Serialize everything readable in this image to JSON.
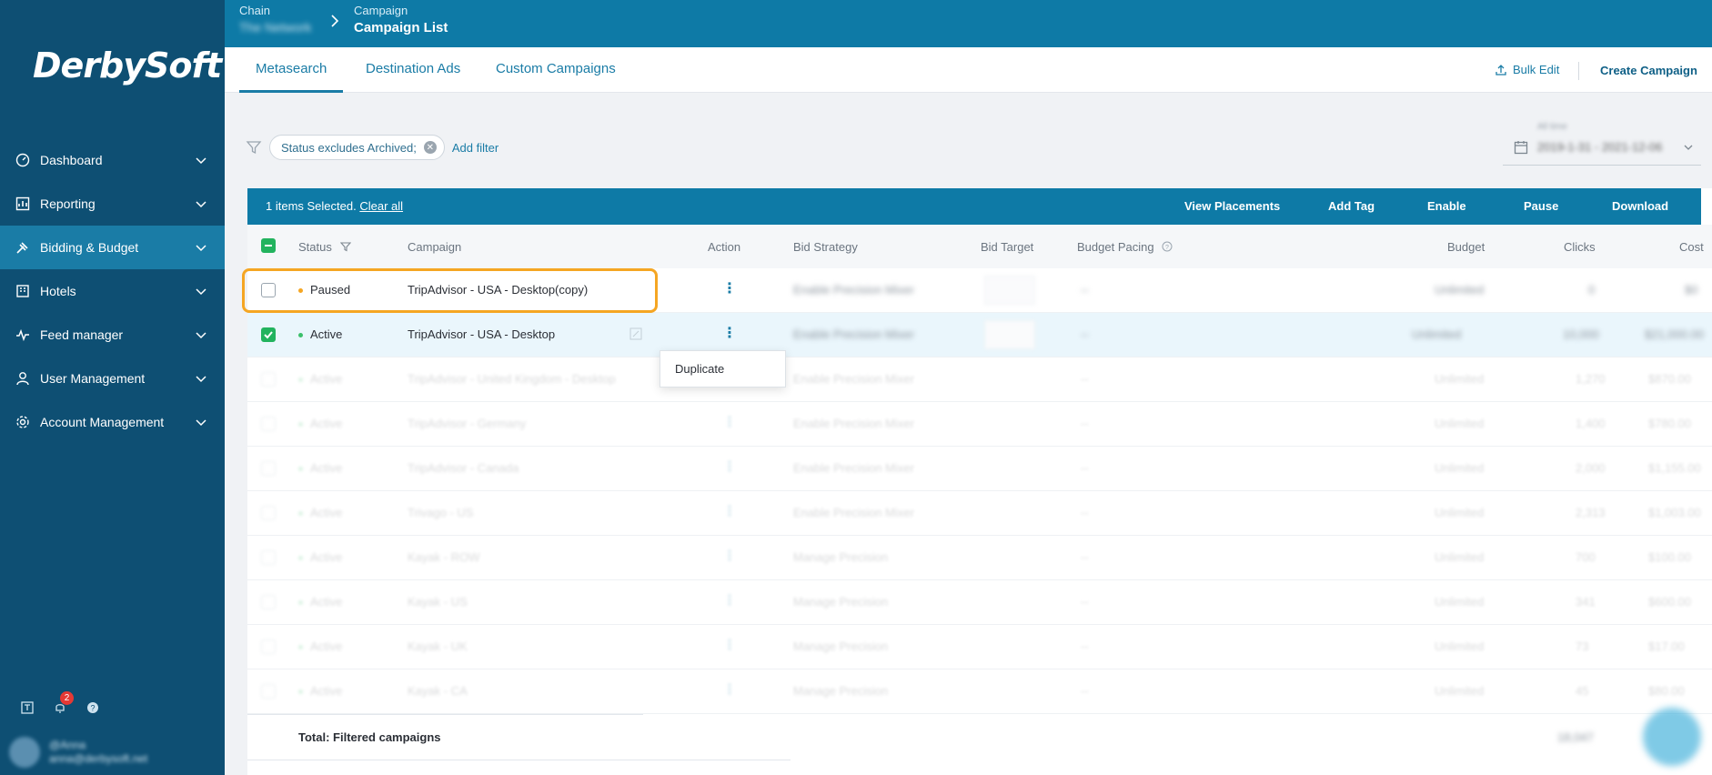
{
  "brand": {
    "logo": "DerbySoft"
  },
  "sidebar": {
    "items": [
      {
        "label": "Dashboard",
        "icon": "dashboard-icon"
      },
      {
        "label": "Reporting",
        "icon": "reporting-icon"
      },
      {
        "label": "Bidding & Budget",
        "icon": "bidding-icon",
        "active": true
      },
      {
        "label": "Hotels",
        "icon": "hotels-icon"
      },
      {
        "label": "Feed manager",
        "icon": "feed-icon"
      },
      {
        "label": "User Management",
        "icon": "user-icon"
      },
      {
        "label": "Account Management",
        "icon": "gear-icon"
      }
    ],
    "notification_count": "2",
    "user": {
      "name": "@Anna",
      "email": "anna@derbysoft.net"
    }
  },
  "header": {
    "chain_label": "Chain",
    "chain_value": "The Network",
    "campaign_label": "Campaign",
    "campaign_value": "Campaign List"
  },
  "tabs": [
    "Metasearch",
    "Destination Ads",
    "Custom Campaigns"
  ],
  "toolbar": {
    "bulk_edit": "Bulk Edit",
    "create_campaign": "Create Campaign"
  },
  "filters": {
    "chip": "Status excludes Archived;",
    "add_filter": "Add filter"
  },
  "date_range": {
    "label": "All time",
    "value": "2019-1-31 - 2021-12-06"
  },
  "action_bar": {
    "selected": "1 items Selected.",
    "clear_all": "Clear all",
    "buttons": [
      "View Placements",
      "Add Tag",
      "Enable",
      "Pause",
      "Download"
    ]
  },
  "columns": [
    "Status",
    "Campaign",
    "Action",
    "Bid Strategy",
    "Bid Target",
    "Budget Pacing",
    "Budget",
    "Clicks",
    "Cost"
  ],
  "rows": [
    {
      "status": "Paused",
      "dot": "orange",
      "campaign": "TripAdvisor - USA - Desktop(copy)",
      "strategy": "Enable Precision Mixer",
      "pacing": "--",
      "budget": "Unlimited",
      "clicks": "0",
      "cost": "$0"
    },
    {
      "status": "Active",
      "dot": "green",
      "campaign": "TripAdvisor - USA - Desktop",
      "strategy": "Enable Precision Mixer",
      "pacing": "--",
      "budget": "Unlimited",
      "clicks": "10,000",
      "cost": "$21,000.00"
    },
    {
      "status": "Active",
      "dot": "green",
      "campaign": "TripAdvisor - United Kingdom - Desktop",
      "strategy": "Enable Precision Mixer",
      "pacing": "--",
      "budget": "Unlimited",
      "clicks": "1,270",
      "cost": "$870.00"
    },
    {
      "status": "Active",
      "dot": "green",
      "campaign": "TripAdvisor - Germany",
      "strategy": "Enable Precision Mixer",
      "pacing": "--",
      "budget": "Unlimited",
      "clicks": "1,400",
      "cost": "$780.00"
    },
    {
      "status": "Active",
      "dot": "green",
      "campaign": "TripAdvisor - Canada",
      "strategy": "Enable Precision Mixer",
      "pacing": "--",
      "budget": "Unlimited",
      "clicks": "2,000",
      "cost": "$1,155.00"
    },
    {
      "status": "Active",
      "dot": "green",
      "campaign": "Trivago - US",
      "strategy": "Enable Precision Mixer",
      "pacing": "--",
      "budget": "Unlimited",
      "clicks": "2,313",
      "cost": "$1,003.00"
    },
    {
      "status": "Active",
      "dot": "green",
      "campaign": "Kayak - ROW",
      "strategy": "Manage Precision",
      "pacing": "--",
      "budget": "Unlimited",
      "clicks": "700",
      "cost": "$100.00"
    },
    {
      "status": "Active",
      "dot": "green",
      "campaign": "Kayak - US",
      "strategy": "Manage Precision",
      "pacing": "--",
      "budget": "Unlimited",
      "clicks": "341",
      "cost": "$600.00"
    },
    {
      "status": "Active",
      "dot": "green",
      "campaign": "Kayak - UK",
      "strategy": "Manage Precision",
      "pacing": "--",
      "budget": "Unlimited",
      "clicks": "73",
      "cost": "$17.00"
    },
    {
      "status": "Active",
      "dot": "green",
      "campaign": "Kayak - CA",
      "strategy": "Manage Precision",
      "pacing": "--",
      "budget": "Unlimited",
      "clicks": "45",
      "cost": "$80.00"
    }
  ],
  "dropdown": {
    "item": "Duplicate"
  },
  "footer": {
    "label": "Total: Filtered campaigns",
    "clicks_total": "18,047"
  },
  "colors": {
    "sidebar": "#0e4f73",
    "header": "#0e7aa6",
    "accent": "#1a7ca6",
    "highlight": "#f5a623",
    "check": "#22b35e"
  }
}
